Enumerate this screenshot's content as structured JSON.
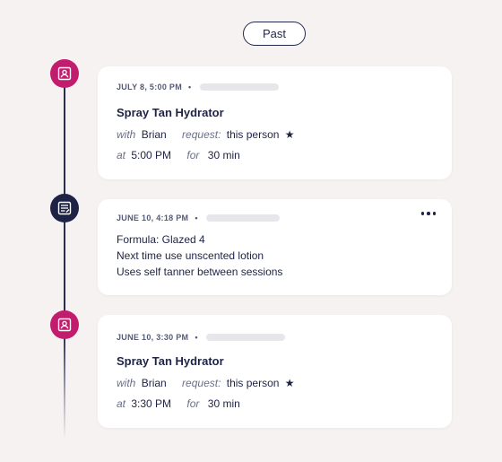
{
  "header": {
    "past_label": "Past"
  },
  "timeline": [
    {
      "type": "appointment",
      "icon": "appointment-icon",
      "date": "JULY 8, 5:00 PM",
      "title": "Spray Tan Hydrator",
      "with_label": "with",
      "with_value": "Brian",
      "request_label": "request:",
      "request_value": "this person",
      "at_label": "at",
      "at_value": "5:00 PM",
      "for_label": "for",
      "for_value": "30 min"
    },
    {
      "type": "note",
      "icon": "note-icon",
      "date": "JUNE 10, 4:18 PM",
      "lines": [
        "Formula: Glazed 4",
        "Next time use unscented lotion",
        "Uses self tanner between sessions"
      ]
    },
    {
      "type": "appointment",
      "icon": "appointment-icon",
      "date": "JUNE 10, 3:30 PM",
      "title": "Spray Tan Hydrator",
      "with_label": "with",
      "with_value": "Brian",
      "request_label": "request:",
      "request_value": "this person",
      "at_label": "at",
      "at_value": "3:30 PM",
      "for_label": "for",
      "for_value": "30 min"
    }
  ],
  "colors": {
    "background": "#f6f2f2",
    "appointment_accent": "#c21c6e",
    "note_accent": "#1e2346",
    "text_primary": "#1e2346"
  }
}
